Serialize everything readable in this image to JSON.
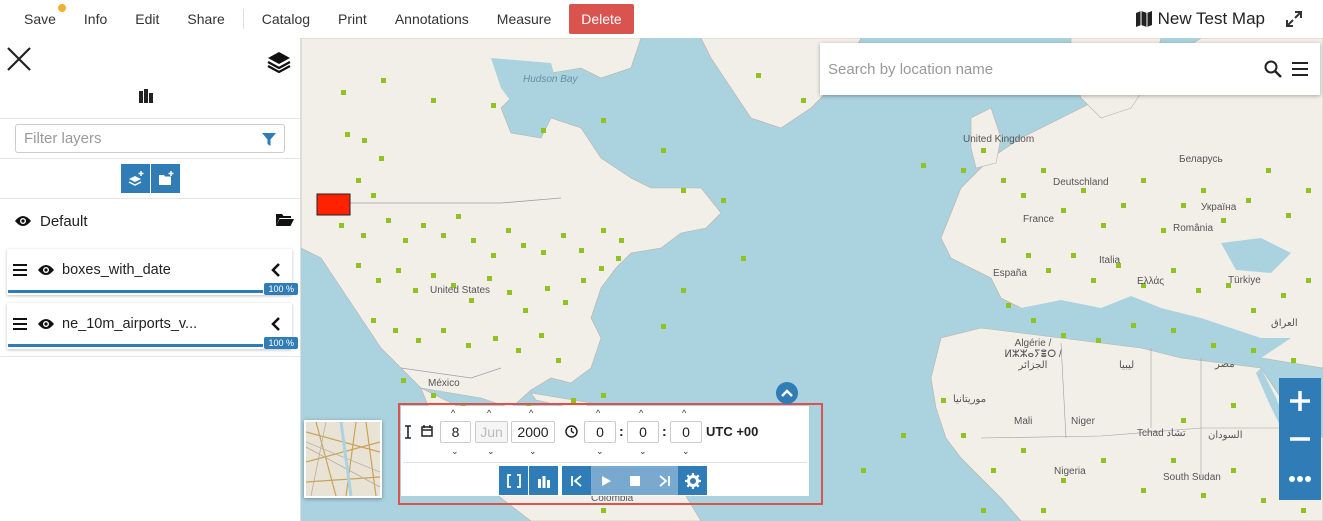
{
  "menu": {
    "save": "Save",
    "info": "Info",
    "edit": "Edit",
    "share": "Share",
    "catalog": "Catalog",
    "print": "Print",
    "annotations": "Annotations",
    "measure": "Measure",
    "delete": "Delete"
  },
  "map_title": "New Test Map",
  "sidebar": {
    "filter_placeholder": "Filter layers",
    "group_name": "Default",
    "layers": [
      {
        "name": "boxes_with_date",
        "opacity": "100 %"
      },
      {
        "name": "ne_10m_airports_v...",
        "opacity": "100 %"
      }
    ]
  },
  "search": {
    "placeholder": "Search by location name"
  },
  "map_labels": {
    "hudson_bay": "Hudson Bay",
    "united_kingdom": "United Kingdom",
    "belarus": "Беларусь",
    "deutschland": "Deutschland",
    "ukraine": "Україна",
    "france": "France",
    "romania": "România",
    "italia": "Italia",
    "espana": "España",
    "ellas": "Ελλάς",
    "turkiye": "Türkiye",
    "iraq": "العراق",
    "united_states": "United States",
    "mexico": "México",
    "algerie": "Algérie / ⵍⵣⵣⴰⵢⴻⵔ / الجزائر",
    "libya": "ليبيا",
    "misr": "مصر",
    "mauritanie": "موريتانيا",
    "mali": "Mali",
    "niger": "Niger",
    "tchad": "Tchad تشاد",
    "sudan": "السودان",
    "nigeria": "Nigeria",
    "south_sudan": "South Sudan",
    "colombia": "Colombia"
  },
  "timeline": {
    "day": "8",
    "month": "Jun",
    "year": "2000",
    "hour": "0",
    "minute": "0",
    "second": "0",
    "utc": "UTC +00"
  },
  "colors": {
    "accent": "#2f7cb6",
    "delete": "#d9534f",
    "water": "#aad3df",
    "land": "#f2efe9",
    "points": "#8fc31f",
    "box": "#ff2200"
  }
}
